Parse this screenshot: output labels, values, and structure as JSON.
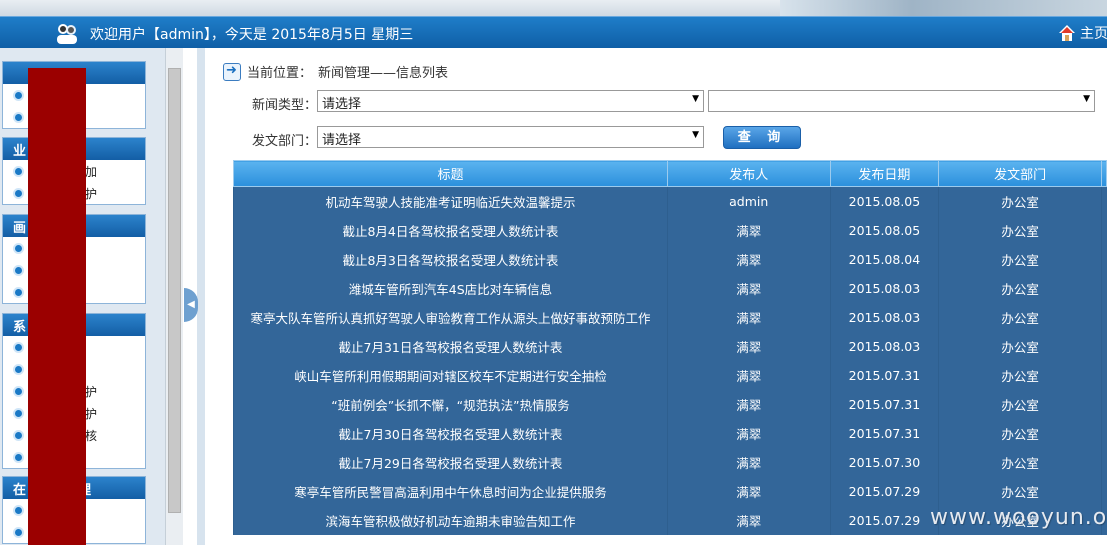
{
  "header": {
    "welcome": "欢迎用户【admin】，今天是 2015年8月5日 星期三",
    "home_label": "主页"
  },
  "sidebar": {
    "groups": [
      {
        "title": "",
        "items": [
          "",
          ""
        ]
      },
      {
        "title": "业",
        "items": [
          "添加",
          "维护"
        ]
      },
      {
        "title": "画",
        "items": [
          "",
          "",
          ""
        ]
      },
      {
        "title": "系",
        "items": [
          "",
          "",
          "维护",
          "维护",
          "审核",
          ""
        ]
      },
      {
        "title": "在",
        "items": [
          "",
          ""
        ]
      }
    ],
    "group_title_suffix": "理"
  },
  "breadcrumb": {
    "label": "当前位置：",
    "path": "新闻管理——信息列表"
  },
  "filters": {
    "type_label": "新闻类型：",
    "type_value": "请选择",
    "subtype_value": "",
    "dept_label": "发文部门：",
    "dept_value": "请选择",
    "query_button": "查 询"
  },
  "table": {
    "headers": [
      "标题",
      "发布人",
      "发布日期",
      "发文部门"
    ],
    "rows": [
      [
        "机动车驾驶人技能准考证明临近失效温馨提示",
        "admin",
        "2015.08.05",
        "办公室"
      ],
      [
        "截止8月4日各驾校报名受理人数统计表",
        "满翠",
        "2015.08.05",
        "办公室"
      ],
      [
        "截止8月3日各驾校报名受理人数统计表",
        "满翠",
        "2015.08.04",
        "办公室"
      ],
      [
        "潍城车管所到汽车4S店比对车辆信息",
        "满翠",
        "2015.08.03",
        "办公室"
      ],
      [
        "寒亭大队车管所认真抓好驾驶人审验教育工作从源头上做好事故预防工作",
        "满翠",
        "2015.08.03",
        "办公室"
      ],
      [
        "截止7月31日各驾校报名受理人数统计表",
        "满翠",
        "2015.08.03",
        "办公室"
      ],
      [
        "峡山车管所利用假期期间对辖区校车不定期进行安全抽检",
        "满翠",
        "2015.07.31",
        "办公室"
      ],
      [
        "“班前例会”长抓不懈，“规范执法”热情服务",
        "满翠",
        "2015.07.31",
        "办公室"
      ],
      [
        "截止7月30日各驾校报名受理人数统计表",
        "满翠",
        "2015.07.31",
        "办公室"
      ],
      [
        "截止7月29日各驾校报名受理人数统计表",
        "满翠",
        "2015.07.30",
        "办公室"
      ],
      [
        "寒亭车管所民警冒高温利用中午休息时间为企业提供服务",
        "满翠",
        "2015.07.29",
        "办公室"
      ],
      [
        "滨海车管积极做好机动车逾期未审验告知工作",
        "满翠",
        "2015.07.29",
        "办公室"
      ]
    ]
  },
  "watermark": "www.wooyun.org"
}
